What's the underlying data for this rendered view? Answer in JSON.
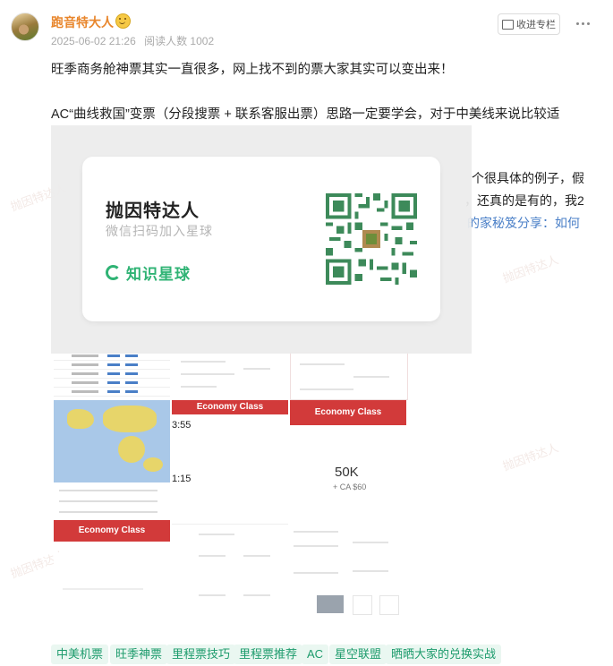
{
  "post": {
    "author": "跑音特大人",
    "date": "2025-06-02 21:26",
    "reads": "阅读人数 1002",
    "collect_label": "收进专栏",
    "paragraphs": [
      "旺季商务舱神票其实一直很多，网上找不到的票大家其实可以变出来！",
      "AC“曲线救国”变票（分段搜票 + 联系客服出票）思路一定要学会，对于中美线来说比较适"
    ],
    "obscured_lines": [
      "个很具体的例子，假",
      "，还真的是有的，我2",
      "的家秘笈分享：如何"
    ]
  },
  "promo": {
    "title": "抛因特达人",
    "subtitle": "微信扫码加入星球",
    "brand": "知识星球"
  },
  "images": {
    "economy_label": "Economy Class",
    "economy_label_2": "Economy Class",
    "economy_label_3": "Economy Class",
    "miles": "50K",
    "taxes": "+ CA $60",
    "time_1": "3:55",
    "time_2": "1:15"
  },
  "tags": [
    "中美机票",
    "旺季神票",
    "里程票技巧",
    "里程票推荐",
    "AC",
    "星空联盟",
    "晒晒大家的兑换实战"
  ],
  "colors": {
    "author": "#e8862c",
    "tag_bg": "#eaf7f1",
    "tag_text": "#1d9b6c",
    "brand": "#2fb374",
    "link": "#4a7fc7"
  }
}
